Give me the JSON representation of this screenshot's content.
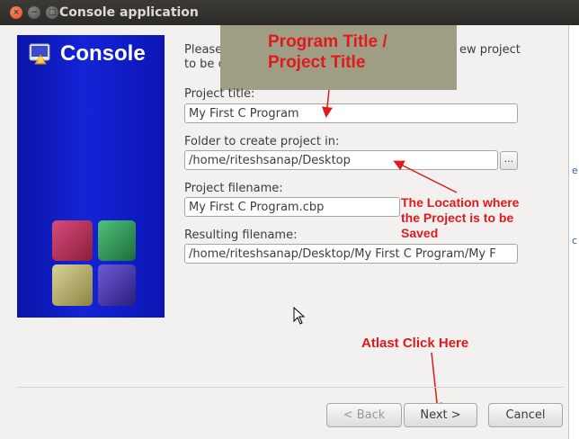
{
  "window": {
    "title": "Console application",
    "close_glyph": "×",
    "minimize_glyph": "−",
    "maximize_glyph": "□"
  },
  "banner": {
    "title": "Console",
    "background": "#0a13a8"
  },
  "intro": {
    "line1_start": "Please s",
    "line1_end": "ew project",
    "line2_start": "to be cre"
  },
  "form": {
    "project_title_label": "Project title:",
    "project_title_value": "My First C Program",
    "folder_label": "Folder to create project in:",
    "folder_value": "/home/riteshsanap/Desktop",
    "browse_label": "...",
    "filename_label": "Project filename:",
    "filename_value": "My First C Program.cbp",
    "result_label": "Resulting filename:",
    "result_value": "/home/riteshsanap/Desktop/My First C Program/My F"
  },
  "annotations": {
    "title_note_line1": "Program Title /",
    "title_note_line2": "Project Title",
    "location_note_line1": "The Location where",
    "location_note_line2": "the Project is to be",
    "location_note_line3": "Saved",
    "click_note": "Atlast Click Here",
    "note_color": "#e0191d",
    "note_box_color": "#9f9e85"
  },
  "buttons": {
    "back": "< Back",
    "next": "Next >",
    "cancel": "Cancel"
  },
  "background_window": {
    "link1": "e",
    "link2": "c"
  }
}
